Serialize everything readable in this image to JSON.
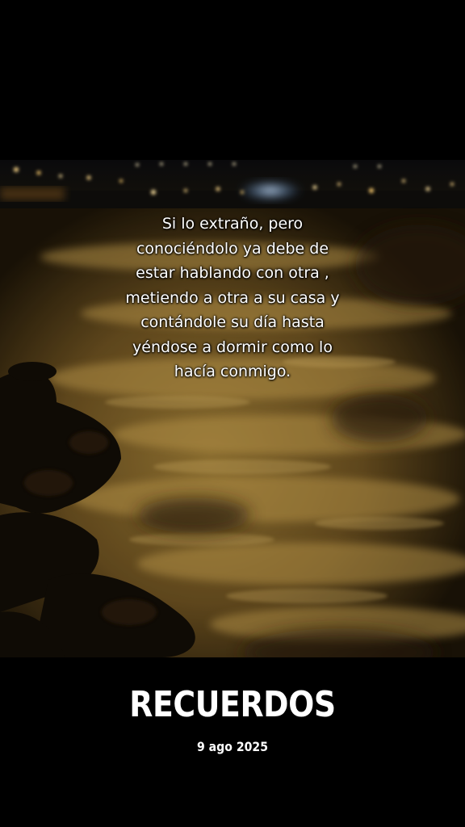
{
  "post": {
    "caption_lines": [
      "Si lo extraño, pero",
      "conociéndolo ya debe de",
      "estar hablando con otra ,",
      "metiendo a otra a su casa y",
      "contándole su día hasta",
      "yéndose a dormir como lo",
      "hacía conmigo."
    ],
    "title": "RECUERDOS",
    "date": "9 ago 2025"
  },
  "colors": {
    "background": "#000000",
    "text": "#ffffff",
    "foam_highlight": "#c9a24f",
    "water_dark": "#2a1e08",
    "city_lights": "#ffd98a"
  },
  "icons": []
}
